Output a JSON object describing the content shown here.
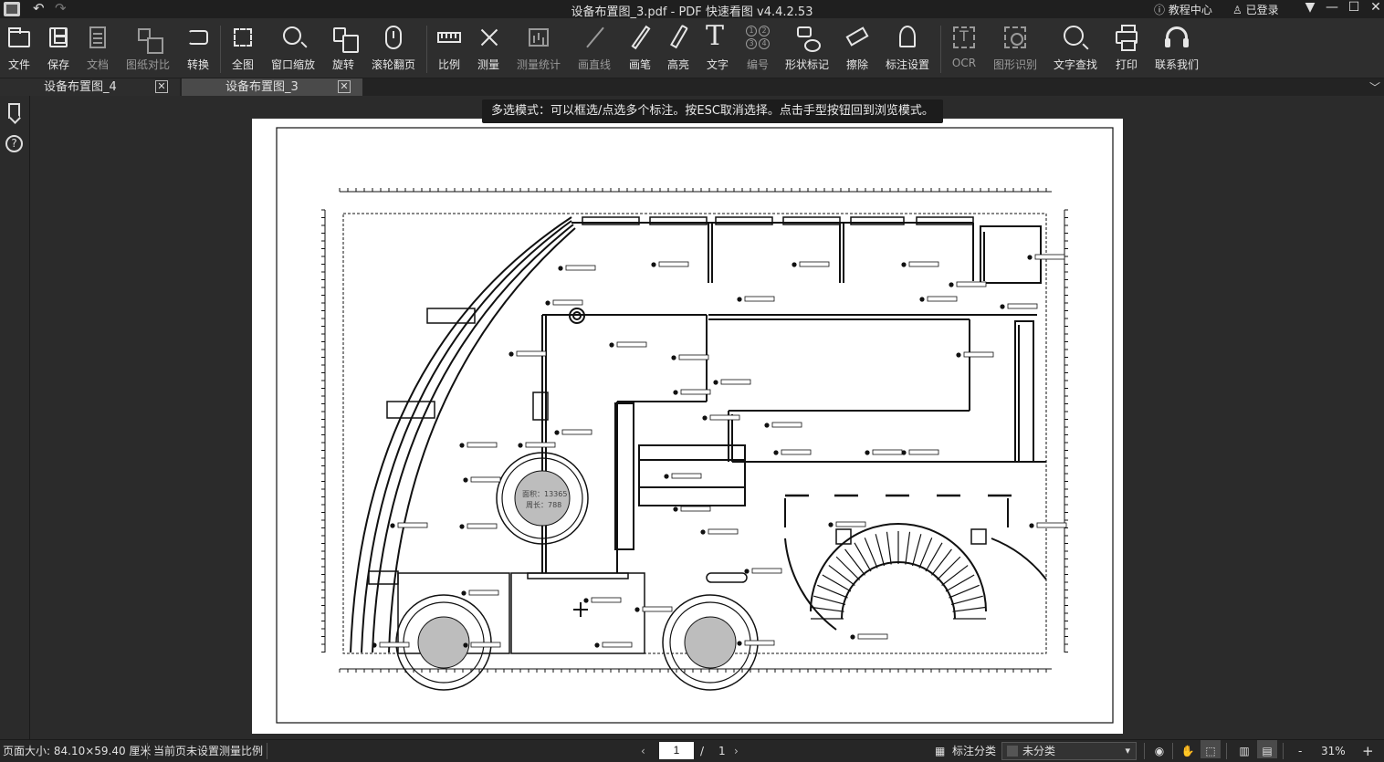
{
  "titlebar": {
    "title": "设备布置图_3.pdf - PDF 快速看图 v4.4.2.53",
    "tutorial": "教程中心",
    "user": "已登录",
    "undo_icon": "undo-icon",
    "redo_icon": "redo-icon"
  },
  "toolbar": {
    "open": "文件",
    "save": "保存",
    "doc": "文档",
    "compare": "图纸对比",
    "convert": "转换",
    "fit": "全图",
    "window_zoom": "窗口缩放",
    "rotate": "旋转",
    "scroll_page": "滚轮翻页",
    "scale": "比例",
    "measure": "测量",
    "measure_stats": "测量统计",
    "draw_line": "画直线",
    "pen": "画笔",
    "highlight": "高亮",
    "text": "文字",
    "number": "编号",
    "shape_mark": "形状标记",
    "erase": "擦除",
    "mark_settings": "标注设置",
    "ocr": "OCR",
    "image_recognition": "图形识别",
    "text_search": "文字查找",
    "print": "打印",
    "contact": "联系我们"
  },
  "tabs": [
    {
      "label": "设备布置图_4",
      "active": false
    },
    {
      "label": "设备布置图_3",
      "active": true
    }
  ],
  "tooltip": "多选模式：可以框选/点选多个标注。按ESC取消选择。点击手型按钮回到浏览模式。",
  "drawing": {
    "center_label_1": "面积：13365",
    "center_label_2": "周长：788"
  },
  "statusbar": {
    "page_size": "页面大小: 84.10×59.40 厘米",
    "scale_note": "当前页未设置测量比例",
    "current_page": "1",
    "page_sep": "/",
    "total_pages": "1",
    "mark_category": "标注分类",
    "category_value": "未分类",
    "zoom": "31%",
    "zoom_out": "-",
    "zoom_in": "+"
  },
  "colors": {
    "background": "#2b2b2b",
    "toolbar": "#2e2e2e",
    "active_tab": "#4a4a4a",
    "page": "#ffffff"
  }
}
